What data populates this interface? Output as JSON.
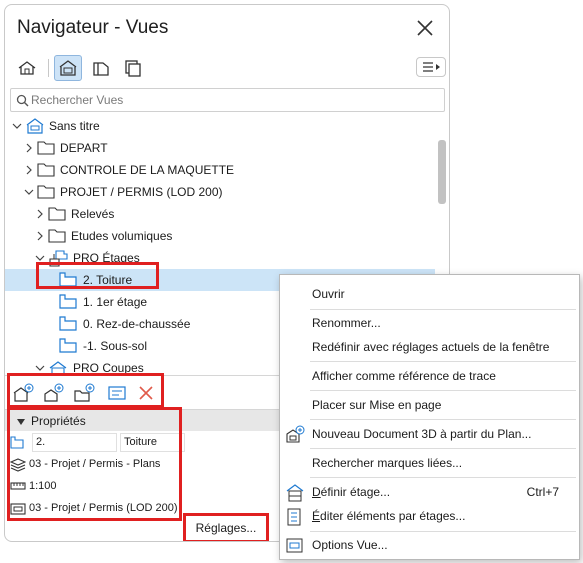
{
  "window": {
    "title": "Navigateur - Vues"
  },
  "search": {
    "placeholder": "Rechercher Vues"
  },
  "tree": {
    "root": "Sans titre",
    "depart": "DEPART",
    "controle": "CONTROLE DE LA MAQUETTE",
    "projet": "PROJET / PERMIS (LOD 200)",
    "releves": "Relevés",
    "etudes": "Etudes volumiques",
    "etages": "PRO Étages",
    "toiture": "2. Toiture",
    "etage1": "1. 1er étage",
    "rdc": "0. Rez-de-chaussée",
    "soussol": "-1. Sous-sol",
    "coupes": "PRO Coupes"
  },
  "properties": {
    "header": "Propriétés",
    "id_value": "2.",
    "name_value": "Toiture",
    "layer_combo": "03 - Projet / Permis - Plans",
    "scale": "1:100",
    "model_view": "03 - Projet / Permis (LOD 200)",
    "settings_button": "Réglages..."
  },
  "context_menu": {
    "ouvrir": "Ouvrir",
    "renommer": "Renommer...",
    "redefinir": "Redéfinir avec réglages actuels de la fenêtre",
    "afficher": "Afficher comme référence de trace",
    "placer": "Placer sur Mise en page",
    "nouveau3d": "Nouveau Document 3D à partir du Plan...",
    "rechercher": "Rechercher marques liées...",
    "definir_first": "D",
    "definir_rest": "éfinir étage...",
    "definir_shortcut": "Ctrl+7",
    "editer_first": "É",
    "editer_rest": "diter éléments par étages...",
    "options": "Options Vue..."
  },
  "colors": {
    "accent_blue": "#1f7ad1",
    "selection": "#cce4f7",
    "highlight_red": "#e02020",
    "delete_red": "#e05a4a"
  }
}
